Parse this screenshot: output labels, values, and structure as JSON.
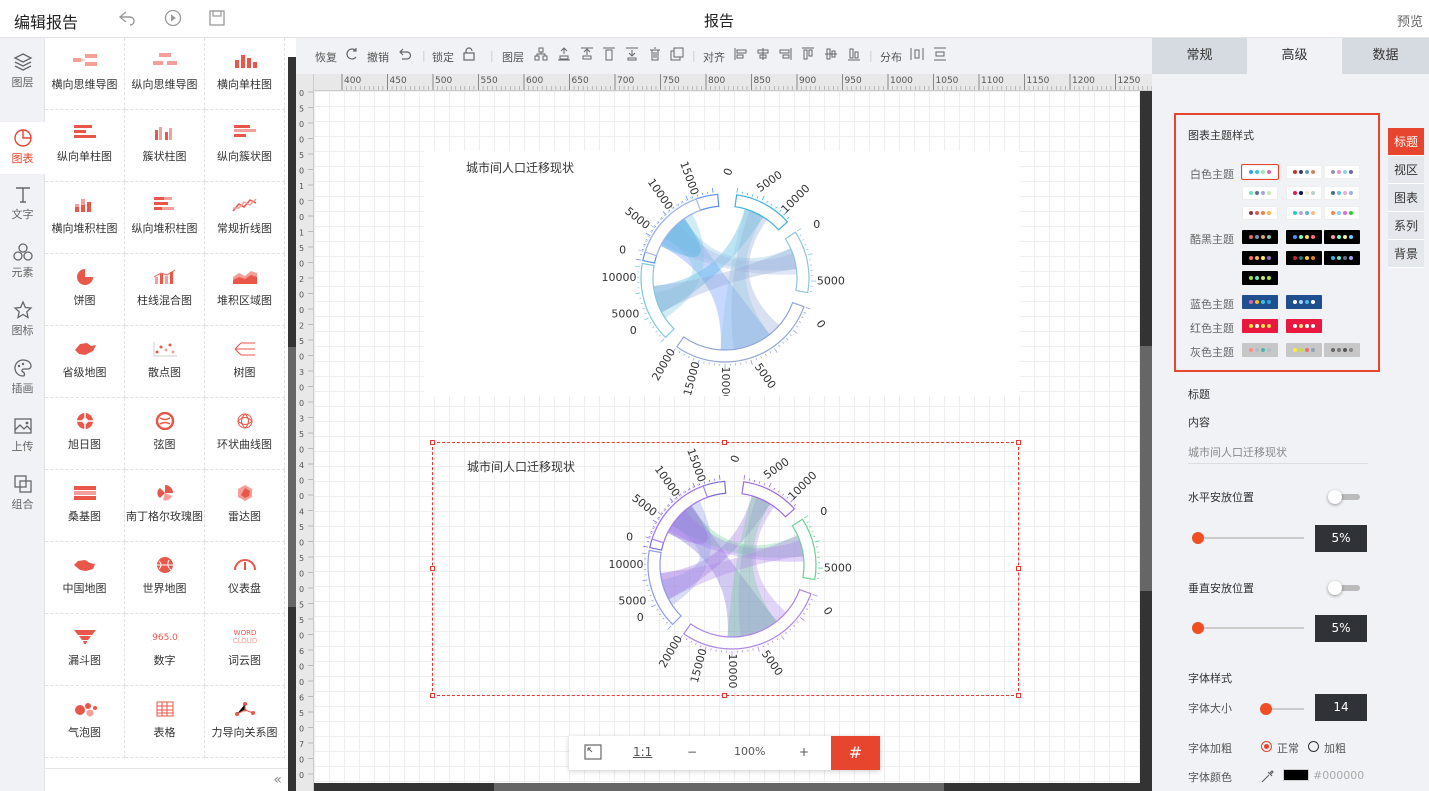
{
  "header": {
    "title": "编辑报告",
    "center_title": "报告",
    "preview_label": "预览"
  },
  "leftnav": [
    {
      "label": "图层",
      "icon": "layers-icon"
    },
    {
      "label": "图表",
      "icon": "chart-icon"
    },
    {
      "label": "文字",
      "icon": "text-icon"
    },
    {
      "label": "元素",
      "icon": "elements-icon"
    },
    {
      "label": "图标",
      "icon": "star-icon"
    },
    {
      "label": "插画",
      "icon": "palette-icon"
    },
    {
      "label": "上传",
      "icon": "image-upload-icon"
    },
    {
      "label": "组合",
      "icon": "combine-icon"
    }
  ],
  "palette": [
    "横向思维导图",
    "纵向思维导图",
    "横向单柱图",
    "纵向单柱图",
    "簇状柱图",
    "纵向簇状图",
    "横向堆积柱图",
    "纵向堆积柱图",
    "常规折线图",
    "饼图",
    "柱线混合图",
    "堆积区域图",
    "省级地图",
    "散点图",
    "树图",
    "旭日图",
    "弦图",
    "环状曲线图",
    "桑基图",
    "南丁格尔玫瑰图",
    "雷达图",
    "中国地图",
    "世界地图",
    "仪表盘",
    "漏斗图",
    "数字",
    "词云图",
    "气泡图",
    "表格",
    "力导向关系图"
  ],
  "toolbar": {
    "redo": "恢复",
    "undo": "撤销",
    "lock": "锁定",
    "layer": "图层",
    "align": "对齐",
    "distribute": "分布"
  },
  "ruler_h": [
    "400",
    "450",
    "500",
    "550",
    "600",
    "650",
    "700",
    "750",
    "800",
    "850",
    "900",
    "950",
    "1000",
    "1050",
    "1100",
    "1150",
    "1200",
    "1250"
  ],
  "ruler_v": [
    "0",
    "5",
    "0",
    "0",
    "5",
    "0",
    "1",
    "0",
    "0",
    "1",
    "5",
    "0",
    "2",
    "0",
    "0",
    "2",
    "5",
    "0",
    "3",
    "0",
    "0",
    "3",
    "5",
    "0",
    "4",
    "0",
    "0",
    "4",
    "5",
    "0",
    "5",
    "0",
    "0",
    "5",
    "5",
    "0",
    "6",
    "0",
    "0",
    "6",
    "5",
    "0",
    "7",
    "0",
    "0"
  ],
  "canvas": {
    "chart1_title": "城市间人口迁移现状",
    "chart2_title": "城市间人口迁移现状"
  },
  "chart_data": [
    {
      "type": "chord",
      "title": "城市间人口迁移现状",
      "tick_labels": [
        "15000",
        "10000",
        "5000",
        "0",
        "10000",
        "5000",
        "0",
        "0",
        "5000",
        "10000",
        "0",
        "5000",
        "0",
        "5000",
        "10000",
        "15000",
        "20000"
      ]
    },
    {
      "type": "chord",
      "title": "城市间人口迁移现状",
      "tick_labels": [
        "15000",
        "10000",
        "5000",
        "0",
        "10000",
        "5000",
        "0",
        "0",
        "5000",
        "10000",
        "0",
        "5000",
        "0",
        "5000",
        "10000",
        "15000",
        "20000"
      ]
    }
  ],
  "zoom": {
    "fit": "",
    "one_to_one": "1:1",
    "minus": "−",
    "percent": "100%",
    "plus": "+"
  },
  "panel": {
    "tabs": [
      "常规",
      "高级",
      "数据"
    ],
    "active_tab": "高级",
    "side_tabs": [
      "标题",
      "视区",
      "图表",
      "系列",
      "背景"
    ],
    "theme_section_title": "图表主题样式",
    "theme_groups": {
      "white": "白色主题",
      "dark": "酷黑主题",
      "blue": "蓝色主题",
      "red": "红色主题",
      "gray": "灰色主题"
    },
    "title_label": "标题",
    "content_label": "内容",
    "content_value": "城市间人口迁移现状",
    "h_position_label": "水平安放位置",
    "h_value": "5%",
    "v_position_label": "垂直安放位置",
    "v_value": "5%",
    "font_style_label": "字体样式",
    "font_size_label": "字体大小",
    "font_size_value": "14",
    "font_weight_label": "字体加粗",
    "weight_normal": "正常",
    "weight_bold": "加粗",
    "font_color_label": "字体颜色",
    "font_color_value": "#000000"
  },
  "colors": {
    "accent": "#e8452e",
    "dark": "#2f3237"
  }
}
